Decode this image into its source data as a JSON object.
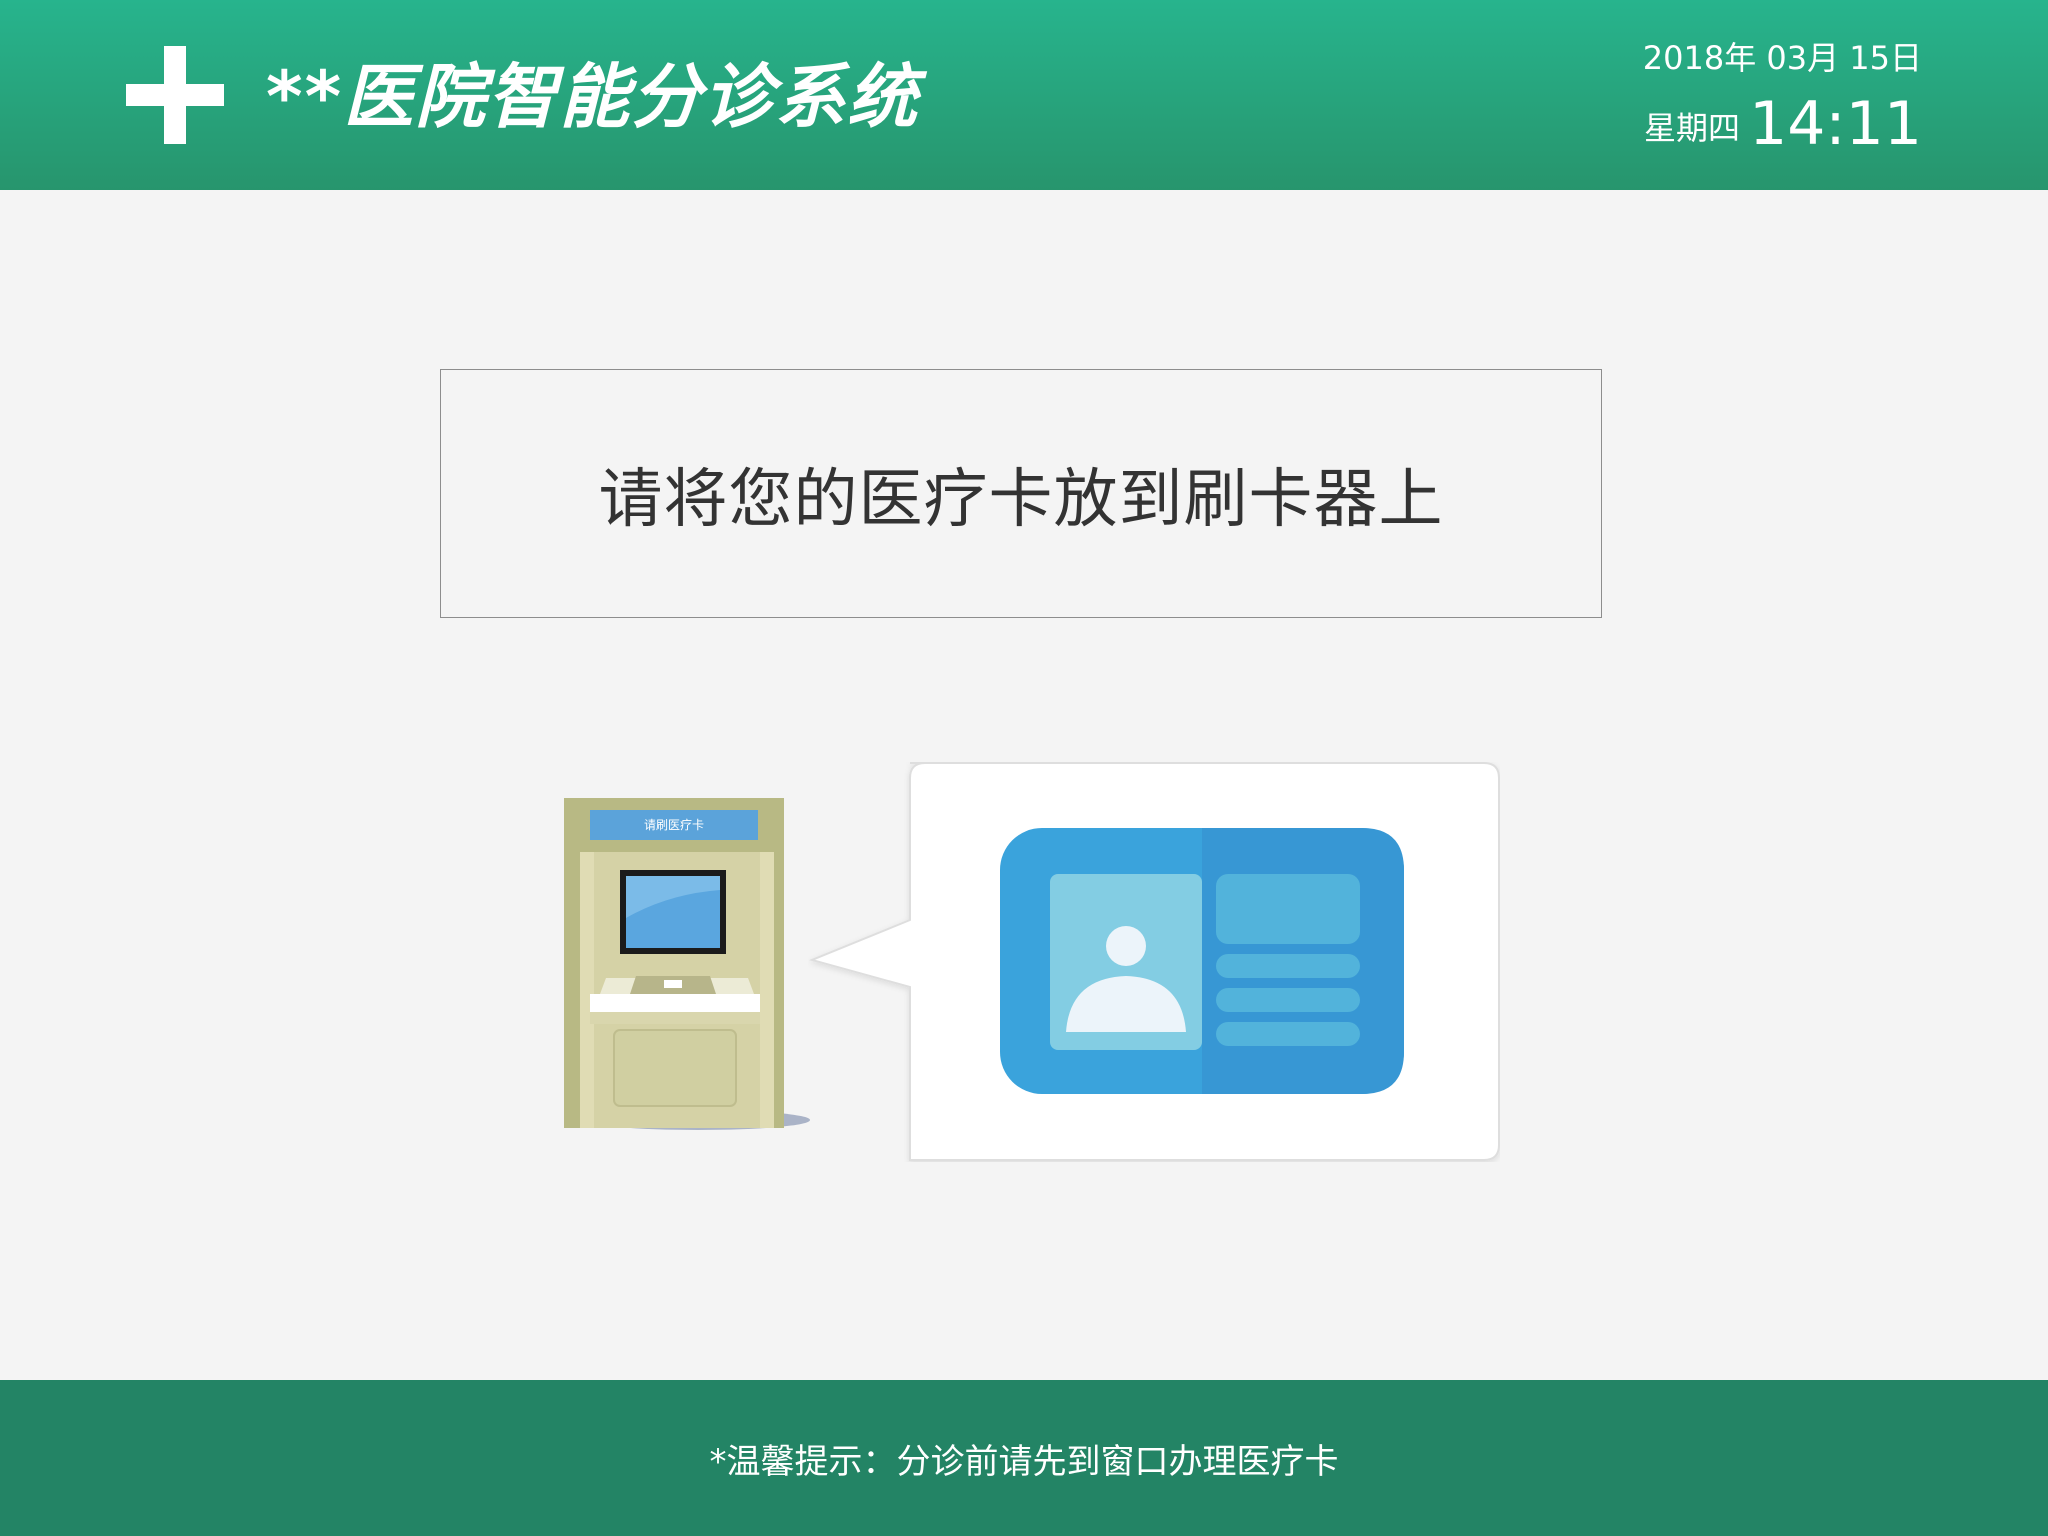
{
  "header": {
    "logo_icon": "plus-icon",
    "title": "**医院智能分诊系统",
    "date": "2018年 03月 15日",
    "weekday": "星期四",
    "time": "14:11",
    "colors": {
      "header_top": "#27b48d",
      "header_bottom": "#27956d"
    }
  },
  "main": {
    "instruction": "请将您的医疗卡放到刷卡器上",
    "illustration": {
      "kiosk_icon": "card-reader-kiosk-icon",
      "kiosk_screen_label": "请刷医疗卡",
      "card_icon": "medical-card-icon"
    }
  },
  "footer": {
    "tip": "*温馨提示：分诊前请先到窗口办理医疗卡",
    "color": "#238465"
  }
}
